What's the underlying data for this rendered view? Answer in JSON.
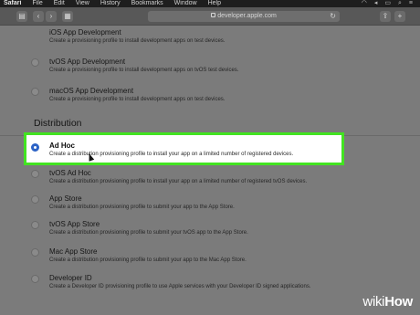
{
  "menubar": {
    "items": [
      "Safari",
      "File",
      "Edit",
      "View",
      "History",
      "Bookmarks",
      "Window",
      "Help"
    ]
  },
  "toolbar": {
    "url": "developer.apple.com"
  },
  "development_options": [
    {
      "title": "iOS App Development",
      "description": "Create a provisioning profile to install development apps on test devices."
    },
    {
      "title": "tvOS App Development",
      "description": "Create a provisioning profile to install development apps on tvOS test devices."
    },
    {
      "title": "macOS App Development",
      "description": "Create a provisioning profile to install development apps on test devices."
    }
  ],
  "distribution": {
    "heading": "Distribution",
    "options": [
      {
        "title": "Ad Hoc",
        "description": "Create a distribution provisioning profile to install your app on a limited number of registered devices.",
        "selected": true
      },
      {
        "title": "tvOS Ad Hoc",
        "description": "Create a distribution provisioning profile to install your app on a limited number of registered tvOS devices."
      },
      {
        "title": "App Store",
        "description": "Create a distribution provisioning profile to submit your app to the App Store."
      },
      {
        "title": "tvOS App Store",
        "description": "Create a distribution provisioning profile to submit your tvOS app to the App Store."
      },
      {
        "title": "Mac App Store",
        "description": "Create a distribution provisioning profile to submit your app to the Mac App Store."
      },
      {
        "title": "Developer ID",
        "description": "Create a Developer ID provisioning profile to use Apple services with your Developer ID signed applications."
      }
    ]
  },
  "colors": {
    "highlight_border": "#42e321",
    "radio_selected": "#2c63c6"
  },
  "watermark": {
    "part1": "wiki",
    "part2": "How"
  }
}
